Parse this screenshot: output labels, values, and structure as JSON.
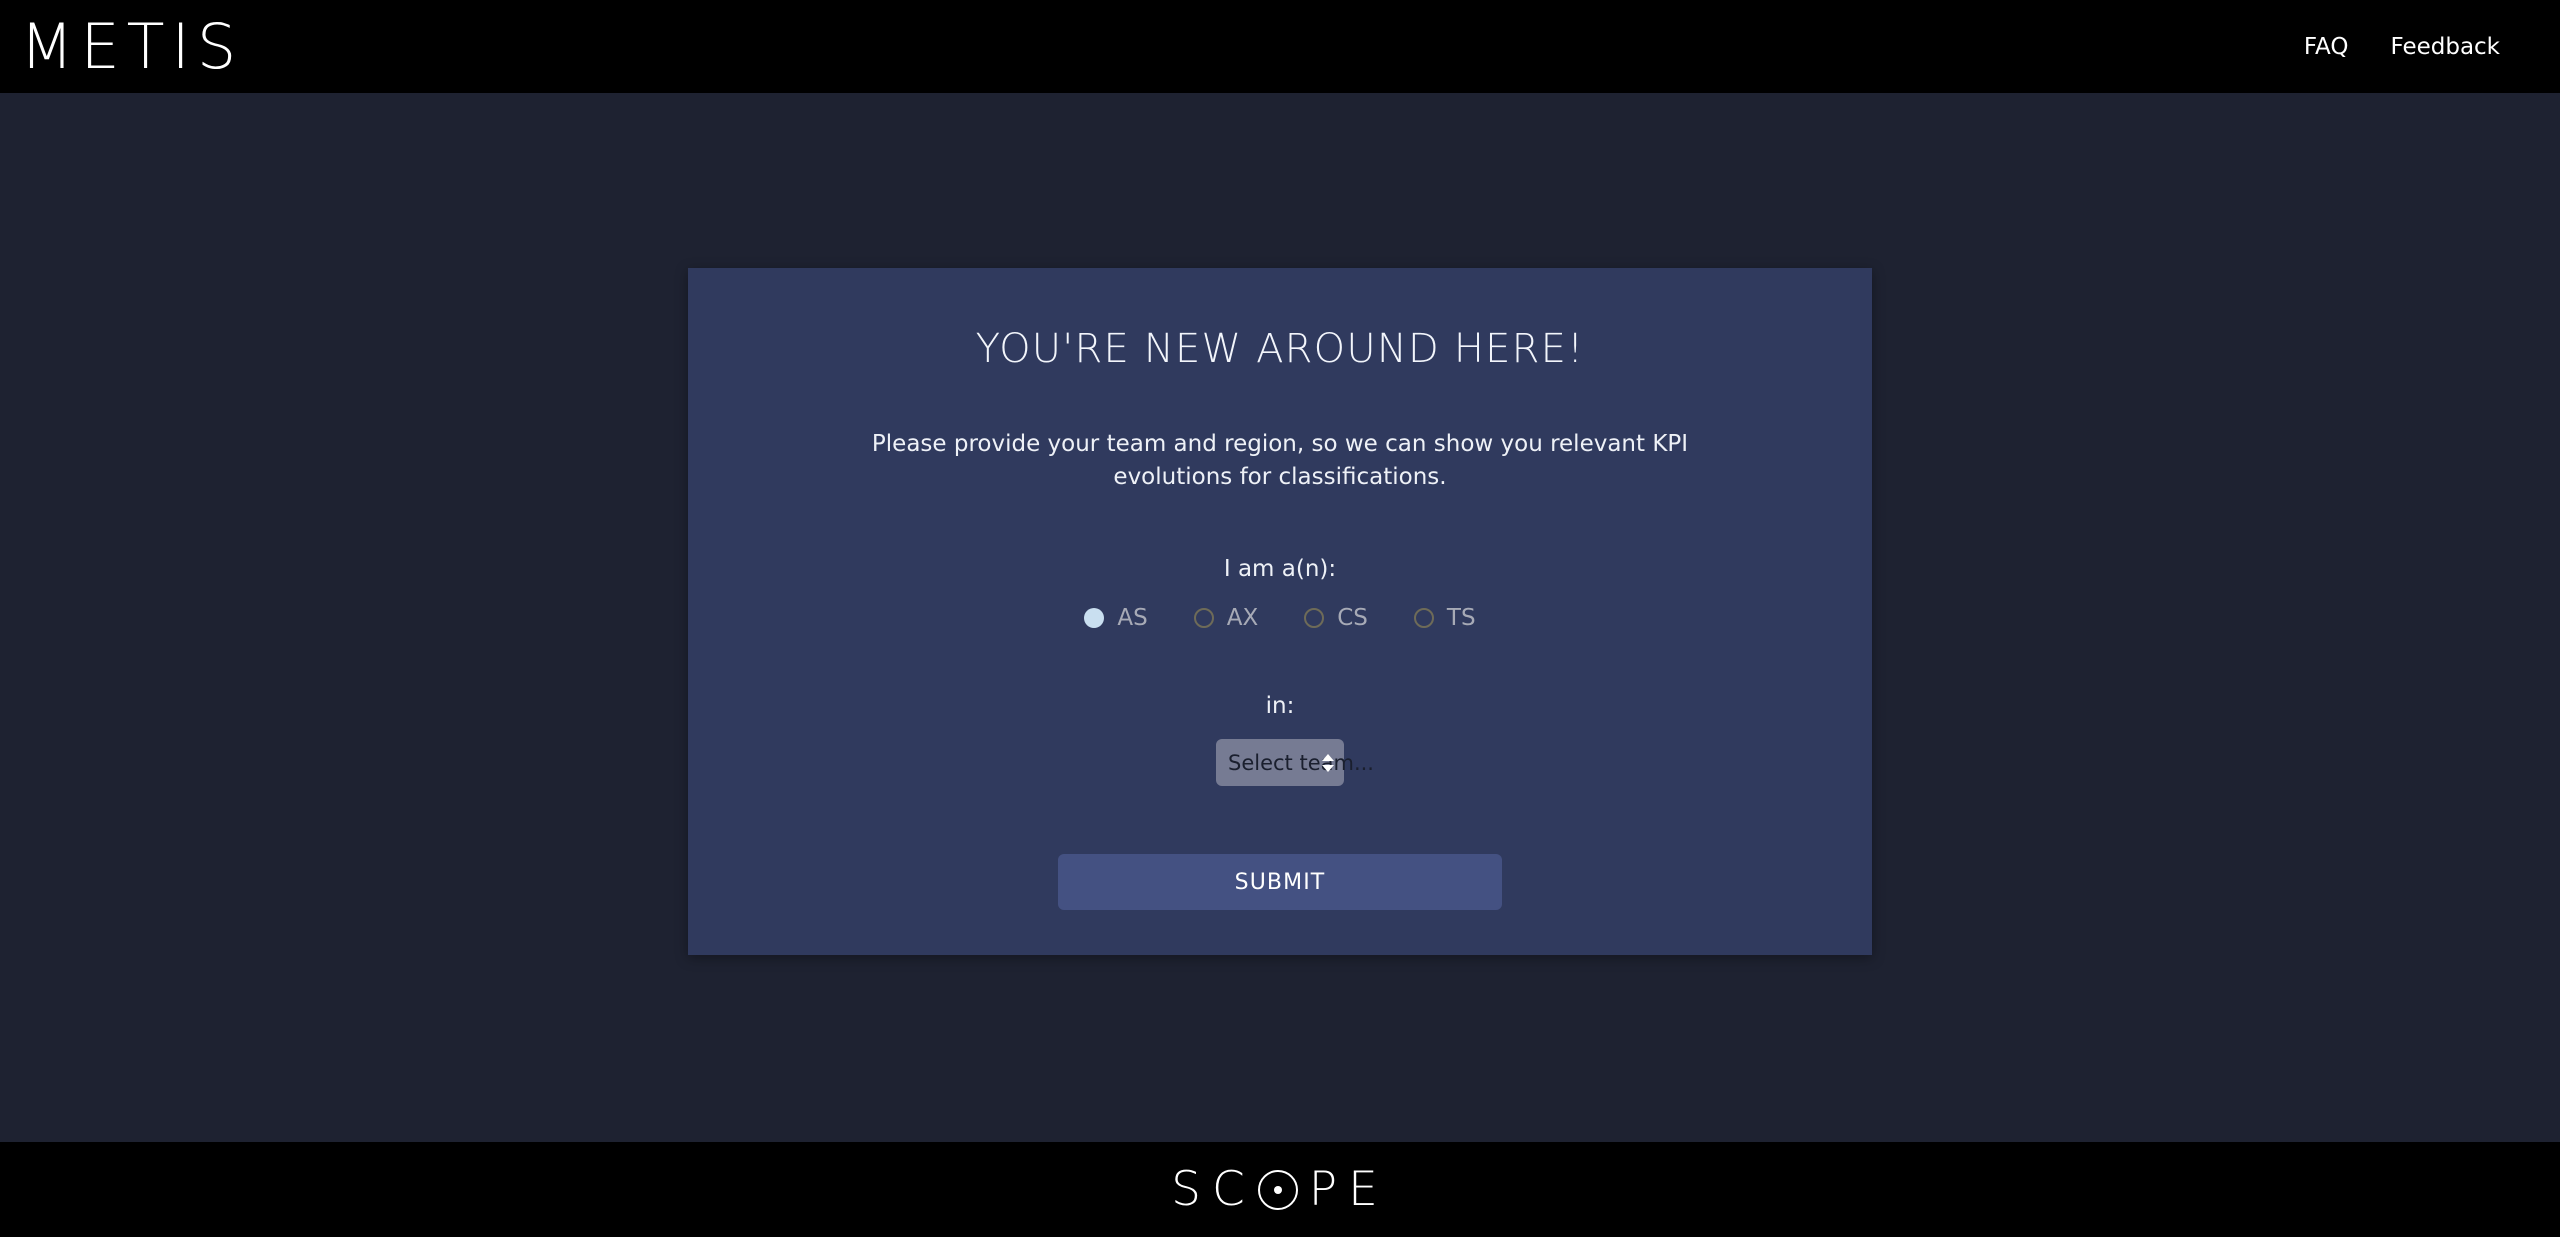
{
  "header": {
    "brand": "METIS",
    "nav": [
      {
        "label": "FAQ"
      },
      {
        "label": "Feedback"
      }
    ]
  },
  "card": {
    "title": "YOU'RE NEW AROUND HERE!",
    "description": "Please provide your team and region, so we can show you relevant KPI evolutions for classifications.",
    "role_label": "I am a(n):",
    "roles": [
      {
        "label": "AS",
        "selected": true
      },
      {
        "label": "AX",
        "selected": false
      },
      {
        "label": "CS",
        "selected": false
      },
      {
        "label": "TS",
        "selected": false
      }
    ],
    "team_label": "in:",
    "team_select": {
      "value": "Select team...",
      "options": [
        "Select team..."
      ]
    },
    "submit_label": "SUBMIT"
  },
  "footer": {
    "brand_part1": "SC",
    "brand_part2": "PE"
  },
  "colors": {
    "page_background": "#1e2231",
    "header_background": "#000000",
    "card_background": "#303a5e",
    "submit_button": "#445182",
    "select_background": "#767b93",
    "radio_selected": "#c9dff0",
    "radio_unselected_border": "#6e6b58"
  }
}
